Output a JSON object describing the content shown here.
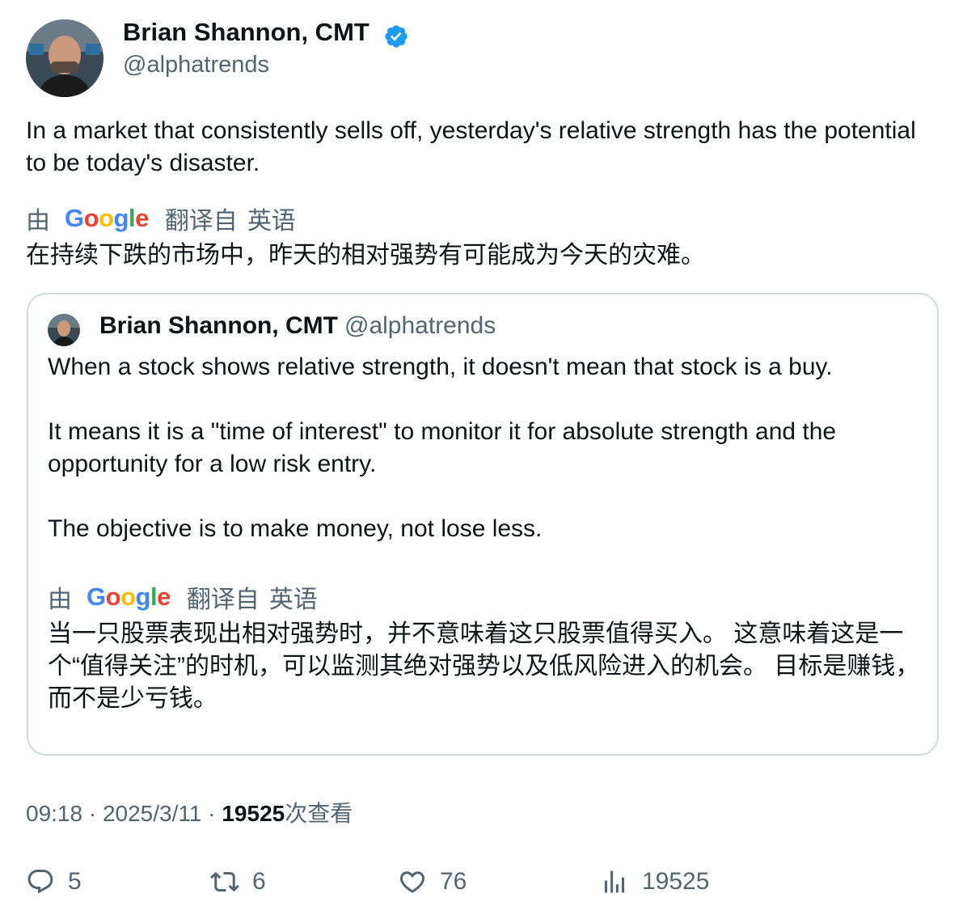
{
  "author": {
    "name": "Brian Shannon, CMT",
    "handle": "@alphatrends",
    "verified": true
  },
  "tweet": {
    "text": "In a market that consistently sells off, yesterday's relative strength has the potential to be today's disaster.",
    "translation": {
      "by": "由",
      "provider": "Google",
      "from": "翻译自",
      "language": "英语",
      "text": "在持续下跌的市场中，昨天的相对强势有可能成为今天的灾难。"
    }
  },
  "quoted": {
    "name": "Brian Shannon, CMT",
    "handle": "@alphatrends",
    "paragraphs": [
      "When a stock shows relative strength, it doesn't mean that stock is a buy.",
      "It means it is a \"time of interest\" to monitor it for absolute strength and the opportunity for a low risk entry.",
      "The objective is to make money, not lose less."
    ],
    "translation": {
      "by": "由",
      "provider": "Google",
      "from": "翻译自",
      "language": "英语",
      "text": "当一只股票表现出相对强势时，并不意味着这只股票值得买入。 这意味着这是一个“值得关注”的时机，可以监测其绝对强势以及低风险进入的机会。 目标是赚钱，而不是少亏钱。"
    }
  },
  "meta": {
    "time": "09:18",
    "separator": "·",
    "date": "2025/3/11",
    "views_count": "19525",
    "views_label": "次查看"
  },
  "actions": {
    "replies": "5",
    "retweets": "6",
    "likes": "76",
    "views": "19525"
  },
  "colors": {
    "text": "#0f1419",
    "secondary": "#536471",
    "border": "#cfd9de",
    "verified": "#1d9bf0"
  },
  "icons": [
    "verified-badge-icon",
    "reply-icon",
    "retweet-icon",
    "like-icon",
    "views-icon"
  ]
}
